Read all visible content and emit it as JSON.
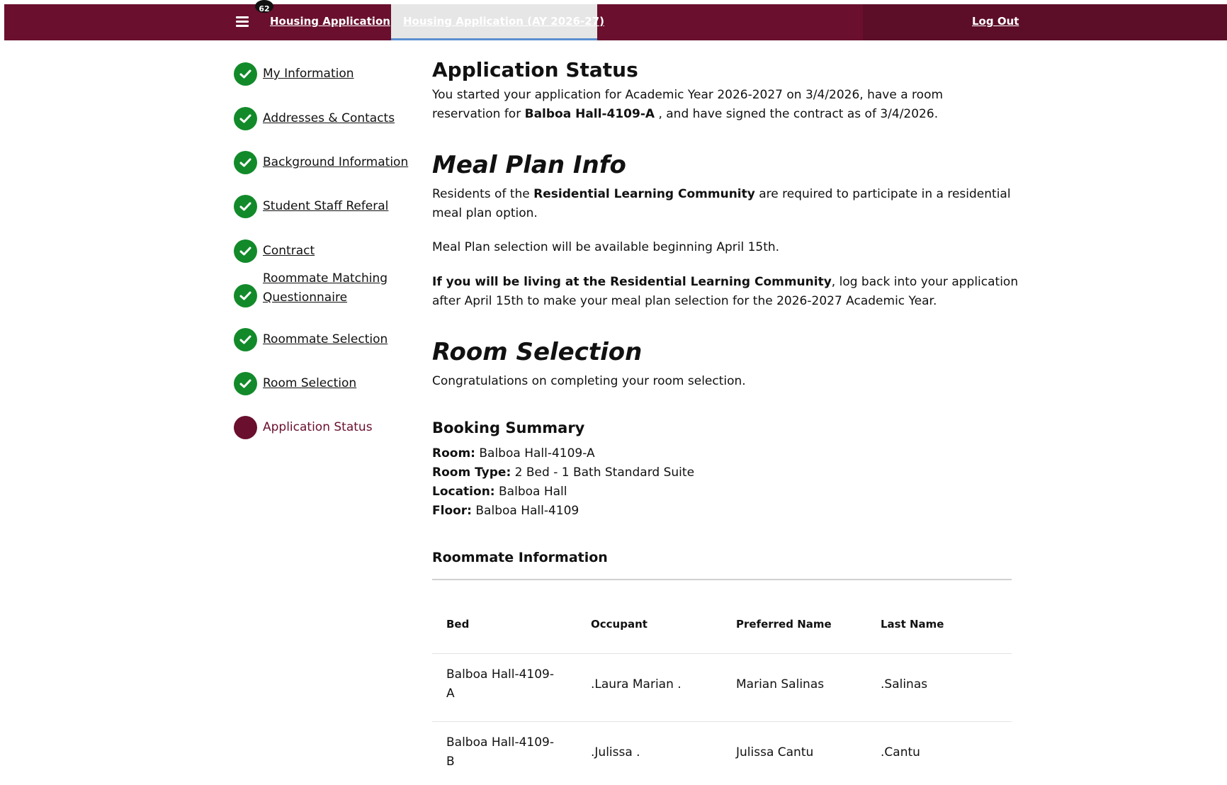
{
  "topbar": {
    "menu_icon": "hamburger-menu-icon",
    "badge": "62",
    "app_link": "Housing Application",
    "active_tab": "Housing Application (AY 2026-27)",
    "logout": "Log Out"
  },
  "sidebar": {
    "items": [
      {
        "label": "My Information",
        "status": "complete"
      },
      {
        "label": "Addresses & Contacts",
        "status": "complete"
      },
      {
        "label": "Background Information",
        "status": "complete"
      },
      {
        "label": "Student Staff Referal",
        "status": "complete"
      },
      {
        "label": "Contract",
        "status": "complete"
      },
      {
        "label_line1": "Roommate Matching",
        "label_line2": "Questionnaire",
        "status": "complete"
      },
      {
        "label": "Roommate Selection",
        "status": "complete"
      },
      {
        "label": "Room Selection",
        "status": "complete"
      },
      {
        "label": "Application Status",
        "status": "current"
      }
    ]
  },
  "status": {
    "heading": "Application Status",
    "line1": "You started your application for Academic Year 2026-2027 on 3/4/2026, have a room",
    "line2_pre": "reservation for ",
    "line2_bold": "Balboa Hall-4109-A",
    "line2_post": " , and have signed the contract as of 3/4/2026."
  },
  "meal": {
    "heading": "Meal Plan Info",
    "p1_pre": "Residents of the ",
    "p1_bold": "Residential Learning Community",
    "p1_post": " are required to participate in a residential",
    "p1_line2": "meal plan option.",
    "p2": "Meal Plan selection will be available beginning April 15th.",
    "p3_bold": "If you will be living at the Residential Learning Community",
    "p3_post": ", log back into your application",
    "p3_line2": "after April 15th to make your meal plan selection for the 2026-2027 Academic Year."
  },
  "room_selection": {
    "heading": "Room Selection",
    "text": "Congratulations on completing your room selection."
  },
  "booking": {
    "heading": "Booking Summary",
    "room_label": "Room:",
    "room_value": " Balboa Hall-4109-A",
    "type_label": "Room Type:",
    "type_value": " 2 Bed - 1 Bath Standard Suite",
    "location_label": "Location:",
    "location_value": " Balboa Hall",
    "floor_label": "Floor:",
    "floor_value": " Balboa Hall-4109"
  },
  "roommates": {
    "heading": "Roommate Information",
    "columns": [
      "Bed",
      "Occupant",
      "Preferred Name",
      "Last Name"
    ],
    "rows": [
      {
        "bed_line1": "Balboa Hall-4109-",
        "bed_line2": "A",
        "occupant": ".Laura Marian .",
        "preferred": "Marian Salinas",
        "last": ".Salinas"
      },
      {
        "bed_line1": "Balboa Hall-4109-",
        "bed_line2": "B",
        "occupant": ".Julissa .",
        "preferred": "Julissa Cantu",
        "last": ".Cantu"
      }
    ]
  },
  "colors": {
    "brand": "#6a0f2e",
    "complete": "#128a2a",
    "tab_underline": "#5b8fd0"
  }
}
